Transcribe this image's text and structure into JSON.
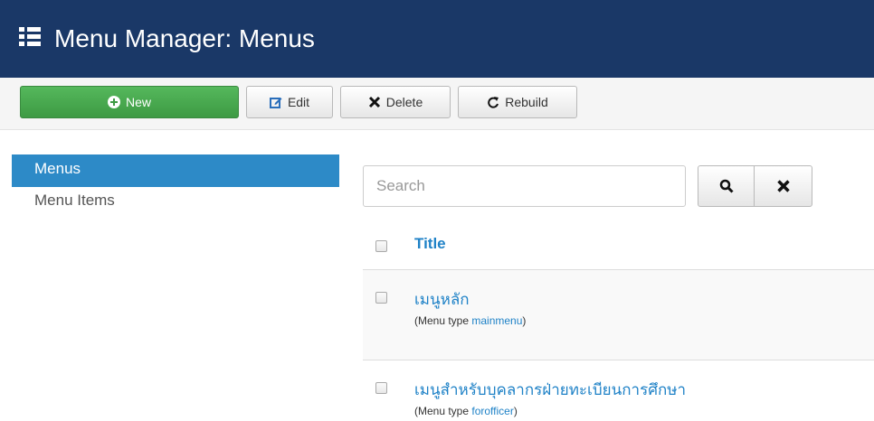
{
  "header": {
    "title": "Menu Manager: Menus",
    "icon": "list-icon",
    "bg_color": "#1a3867"
  },
  "toolbar": {
    "new_label": "New",
    "edit_label": "Edit",
    "delete_label": "Delete",
    "rebuild_label": "Rebuild"
  },
  "sidebar": {
    "items": [
      {
        "label": "Menus",
        "active": true
      },
      {
        "label": "Menu Items",
        "active": false
      }
    ]
  },
  "search": {
    "placeholder": "Search"
  },
  "table": {
    "header_title": "Title",
    "rows": [
      {
        "title": "เมนูหลัก",
        "type_prefix": "(Menu type ",
        "type": "mainmenu",
        "type_suffix": ")"
      },
      {
        "title": "เมนูสำหรับบุคลากรฝ่ายทะเบียนการศึกษา",
        "type_prefix": "(Menu type ",
        "type": "forofficer",
        "type_suffix": ")"
      }
    ]
  },
  "colors": {
    "accent": "#1f82c7",
    "new_button": "#4cae4c",
    "sidebar_active": "#2d8ac7"
  }
}
